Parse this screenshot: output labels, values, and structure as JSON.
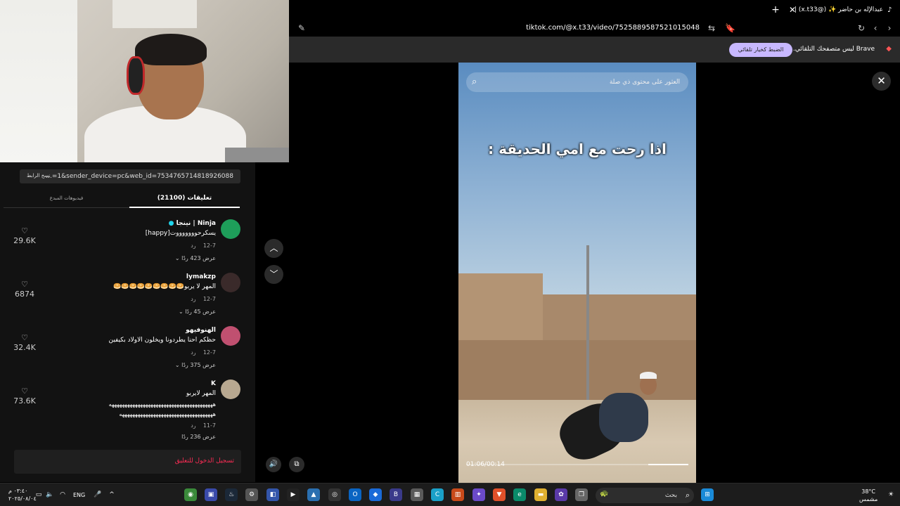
{
  "browser": {
    "tab_title": "عبدالإله بن حاضر ✨ (@x.t33) |",
    "url": "tiktok.com/@x.t33/video/7525889587521015048"
  },
  "notification": {
    "text": "Brave ليس متصفحك التلقائي.",
    "button": "الضبط كخيار تلقائي"
  },
  "panel": {
    "copy_link": "نسخ الرابط",
    "share_url": "...=1&sender_device=pc&web_id=7534765714818926088",
    "tab_comments": "تعليقات (21100)",
    "tab_videos": "فيديوهات المبدع",
    "login_text": "تسجيل الدخول للتعليق"
  },
  "comments": [
    {
      "author": "Ninja | نينجا",
      "text": "يسكرحوووووووت[happy]",
      "date": "12-7",
      "reply": "رد",
      "replies": "عرض 423 ردًا",
      "likes": "29.6K"
    },
    {
      "author": "lymakzp",
      "text": "المهر لا يربو🥯🥯🥯🥯🥯🥯🥯🥯🥯",
      "date": "12-7",
      "reply": "رد",
      "replies": "عرض 45 ردًا",
      "likes": "6874"
    },
    {
      "author": "الهنوفيهو",
      "text": "حظكم احنا يطردونا ويخلون الاولاد بكيفين",
      "date": "12-7",
      "reply": "رد",
      "replies": "عرض 375 ردًا",
      "likes": "32.4K"
    },
    {
      "author": "K",
      "text": "المهر لايربو",
      "text_line2": "ههههههههههههههههههههههههههههههههههههههههه",
      "text_line3": "ههههههههههههههههههههههههههههههههههههه",
      "date": "11-7",
      "reply": "رد",
      "replies": "عرض 236 ردًا",
      "likes": "73.6K"
    }
  ],
  "video": {
    "search_placeholder": "العثور على محتوى ذي صلة",
    "caption": "اذا رحت مع امي الحديقة :",
    "time": "01:06/00:14",
    "progress_percent": 18
  },
  "taskbar": {
    "time": "٠٣:٤٠ م",
    "date": "٢٠٢٥/٠٨/٠٤",
    "language": "ENG",
    "search_label": "بحث",
    "temperature": "38°C",
    "weather": "مشمس"
  }
}
